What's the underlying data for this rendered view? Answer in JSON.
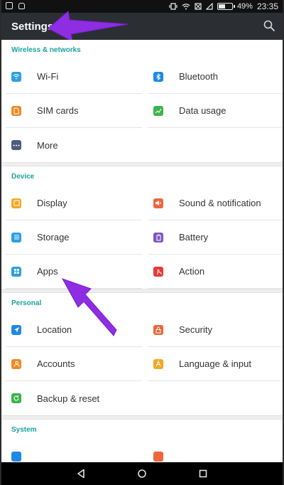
{
  "status_bar": {
    "battery": "49%",
    "time": "23:35"
  },
  "app_bar": {
    "title": "Settings"
  },
  "sections": [
    {
      "header": "Wireless & networks",
      "items": [
        {
          "label": "Wi-Fi",
          "icon": "wifi-icon",
          "color": "#2aa0e0"
        },
        {
          "label": "Bluetooth",
          "icon": "bluetooth-icon",
          "color": "#1e88e5"
        },
        {
          "label": "SIM cards",
          "icon": "sim-card-icon",
          "color": "#f08a24"
        },
        {
          "label": "Data usage",
          "icon": "data-usage-icon",
          "color": "#3bb34a"
        },
        {
          "label": "More",
          "icon": "more-icon",
          "color": "#4a5d7e"
        }
      ]
    },
    {
      "header": "Device",
      "items": [
        {
          "label": "Display",
          "icon": "display-icon",
          "color": "#f5a623"
        },
        {
          "label": "Sound & notification",
          "icon": "sound-icon",
          "color": "#f0643c"
        },
        {
          "label": "Storage",
          "icon": "storage-icon",
          "color": "#2aa0e0"
        },
        {
          "label": "Battery",
          "icon": "battery-icon",
          "color": "#7e57c2"
        },
        {
          "label": "Apps",
          "icon": "apps-icon",
          "color": "#2aa0e0"
        },
        {
          "label": "Action",
          "icon": "action-icon",
          "color": "#e53935"
        }
      ]
    },
    {
      "header": "Personal",
      "items": [
        {
          "label": "Location",
          "icon": "location-icon",
          "color": "#1e88e5"
        },
        {
          "label": "Security",
          "icon": "security-icon",
          "color": "#f0643c"
        },
        {
          "label": "Accounts",
          "icon": "accounts-icon",
          "color": "#f08a24"
        },
        {
          "label": "Language & input",
          "icon": "language-icon",
          "color": "#f5a623"
        },
        {
          "label": "Backup & reset",
          "icon": "backup-icon",
          "color": "#3bb34a"
        }
      ]
    },
    {
      "header": "System",
      "items": []
    }
  ],
  "colors": {
    "accent": "#1aa39a",
    "toolbar": "#2b2f33",
    "annotation_arrow": "#8e2de2"
  }
}
